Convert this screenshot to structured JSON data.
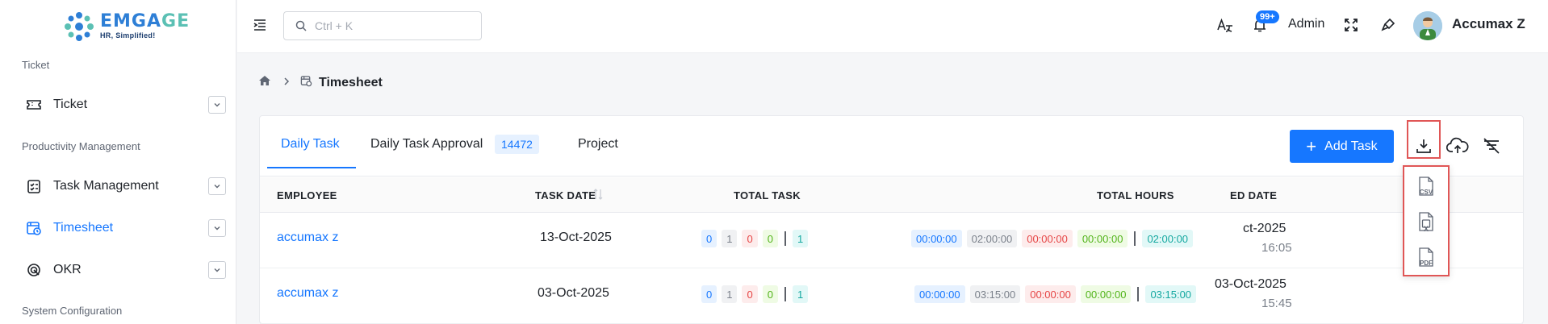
{
  "brand": {
    "name_main": "EMGA",
    "name_accent": "GE",
    "tagline": "HR, Simplified!"
  },
  "sidebar": {
    "sections": [
      {
        "label": "Ticket"
      },
      {
        "label": "Productivity Management"
      },
      {
        "label": "System Configuration"
      }
    ],
    "items": [
      {
        "label": "Ticket",
        "icon": "ticket-icon"
      },
      {
        "label": "Task Management",
        "icon": "task-list-icon"
      },
      {
        "label": "Timesheet",
        "icon": "timesheet-icon",
        "active": true
      },
      {
        "label": "OKR",
        "icon": "target-icon"
      }
    ]
  },
  "header": {
    "search_placeholder": "Ctrl + K",
    "notification_count": "99+",
    "role": "Admin",
    "user_name": "Accumax Z"
  },
  "breadcrumb": {
    "current": "Timesheet"
  },
  "tabs": [
    {
      "label": "Daily Task"
    },
    {
      "label": "Daily Task Approval",
      "count": "14472"
    },
    {
      "label": "Project"
    }
  ],
  "toolbar": {
    "add_task_label": "Add Task"
  },
  "table": {
    "columns": [
      "EMPLOYEE",
      "TASK DATE",
      "TOTAL TASK",
      "TOTAL HOURS",
      "ED DATE"
    ],
    "rows": [
      {
        "employee": "accumax z",
        "task_date": "13-Oct-2025",
        "task_counts": [
          "0",
          "1",
          "0",
          "0",
          "1"
        ],
        "hours": [
          "00:00:00",
          "02:00:00",
          "00:00:00",
          "00:00:00",
          "02:00:00"
        ],
        "updated_date": "ct-2025",
        "updated_time": "16:05"
      },
      {
        "employee": "accumax z",
        "task_date": "03-Oct-2025",
        "task_counts": [
          "0",
          "1",
          "0",
          "0",
          "1"
        ],
        "hours": [
          "00:00:00",
          "03:15:00",
          "00:00:00",
          "00:00:00",
          "03:15:00"
        ],
        "updated_date": "03-Oct-2025",
        "updated_time": "15:45"
      }
    ]
  },
  "export_menu": [
    {
      "icon": "csv-file-icon",
      "label": "CSV"
    },
    {
      "icon": "excel-file-icon",
      "label": "X"
    },
    {
      "icon": "pdf-file-icon",
      "label": "PDF"
    }
  ],
  "colors": {
    "primary": "#1677ff",
    "highlight": "#e05656",
    "teal": "#15a8a0",
    "green": "#52b41a",
    "red": "#e64545"
  }
}
